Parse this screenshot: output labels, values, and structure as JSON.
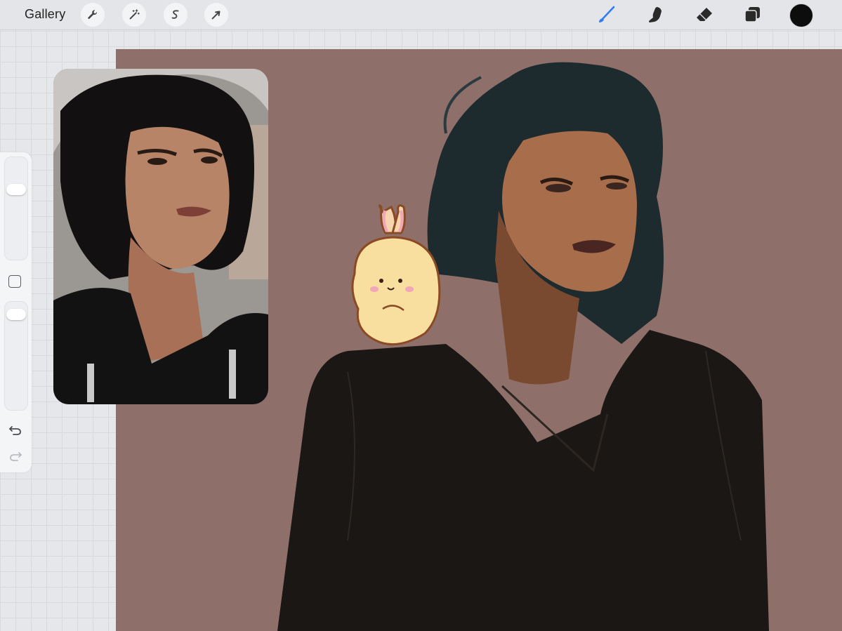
{
  "toolbar": {
    "gallery_label": "Gallery",
    "left_tools": [
      {
        "name": "actions",
        "icon": "wrench-icon"
      },
      {
        "name": "adjustments",
        "icon": "magic-wand-icon"
      },
      {
        "name": "selection",
        "icon": "selection-s-icon"
      },
      {
        "name": "transform",
        "icon": "arrow-cursor-icon"
      }
    ],
    "right_tools": [
      {
        "name": "brush",
        "icon": "brush-icon",
        "active": true
      },
      {
        "name": "smudge",
        "icon": "smudge-finger-icon"
      },
      {
        "name": "eraser",
        "icon": "eraser-icon"
      },
      {
        "name": "layers",
        "icon": "layers-icon"
      }
    ],
    "current_color": "#0d0d0d",
    "accent_color": "#2f7cf6"
  },
  "sidebar": {
    "size_slider_icon": "slider-thumb",
    "modify_icon": "square-icon",
    "opacity_slider_icon": "slider-thumb",
    "undo_icon": "undo-icon",
    "redo_icon": "redo-icon"
  },
  "canvas": {
    "background_color": "#8f6f69"
  },
  "reference_panel": {
    "icon": "reference-photo"
  }
}
